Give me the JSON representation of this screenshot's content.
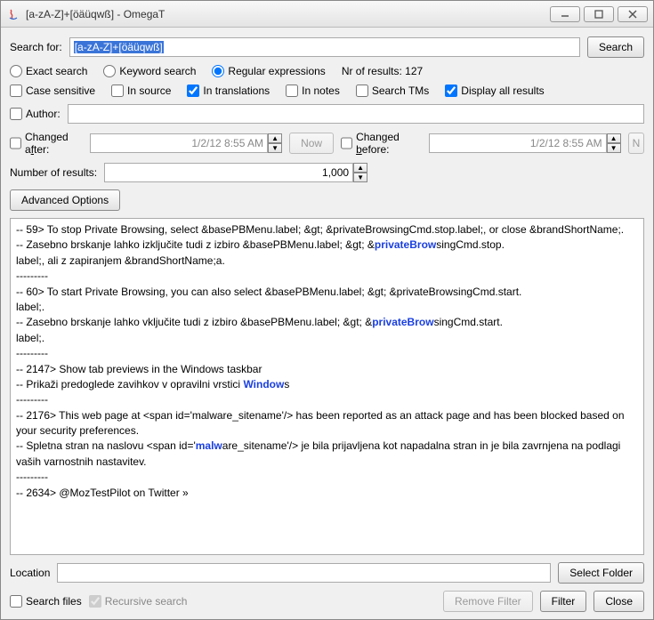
{
  "window": {
    "title": "[a-zA-Z]+[öäüqwß] - OmegaT"
  },
  "searchfor": {
    "label": "Search for:",
    "value": "[a-zA-Z]+[öäüqwß]",
    "button": "Search"
  },
  "mode": {
    "exact": "Exact search",
    "keyword": "Keyword search",
    "regex": "Regular expressions",
    "results_label": "Nr of results: 127"
  },
  "opts": {
    "case": "Case sensitive",
    "insource": "In source",
    "intrans": "In translations",
    "innotes": "In notes",
    "searchtms": "Search TMs",
    "displayall": "Display all results"
  },
  "author": {
    "label": "Author:",
    "value": ""
  },
  "changed": {
    "after_label": "Changed after:",
    "after_val": "1/2/12 8:55 AM",
    "now": "Now",
    "before_label": "Changed before:",
    "before_val": "1/2/12 8:55 AM",
    "now2": "Now"
  },
  "numres": {
    "label": "Number of results:",
    "value": "1,000"
  },
  "adv": "Advanced Options",
  "results_text": {
    "l1a": "-- 59> To stop Private Browsing, select &basePBMenu.label; &gt; &privateBrowsingCmd.stop.label;, or close &brandShortName;.",
    "l2a": "-- Zasebno brskanje lahko izključite tudi z izbiro &basePBMenu.label; &gt; &",
    "l2hl": "privateBrow",
    "l2b": "singCmd.stop.",
    "l2c": "label;, ali z zapiranjem &brandShortName;a.",
    "sep": "---------",
    "l3a": "-- 60> To start Private Browsing, you can also select &basePBMenu.label; &gt; &privateBrowsingCmd.start.",
    "l3b": "label;.",
    "l4a": "-- Zasebno brskanje lahko vključite tudi z izbiro &basePBMenu.label; &gt; &",
    "l4hl": "privateBrow",
    "l4b": "singCmd.start.",
    "l4c": "label;.",
    "l5": "-- 2147> Show tab previews in the Windows taskbar",
    "l6a": "-- Prikaži predoglede zavihkov v opravilni vrstici ",
    "l6hl": "Window",
    "l6b": "s",
    "l7a": "-- 2176> This web page at <span id='malware_sitename'/> has been reported as an attack page and has been blocked based on your security preferences.",
    "l8a": "-- Spletna stran na naslovu <span id='",
    "l8hl": "malw",
    "l8b": "are_sitename'/> je bila prijavljena kot napadalna stran in je bila zavrnjena na podlagi vaših varnostnih nastavitev.",
    "l9": "-- 2634> @MozTestPilot on Twitter »"
  },
  "location": {
    "label": "Location",
    "value": "",
    "select": "Select Folder"
  },
  "footer": {
    "searchfiles": "Search files",
    "recursive": "Recursive search",
    "removefilter": "Remove Filter",
    "filter": "Filter",
    "close": "Close"
  }
}
